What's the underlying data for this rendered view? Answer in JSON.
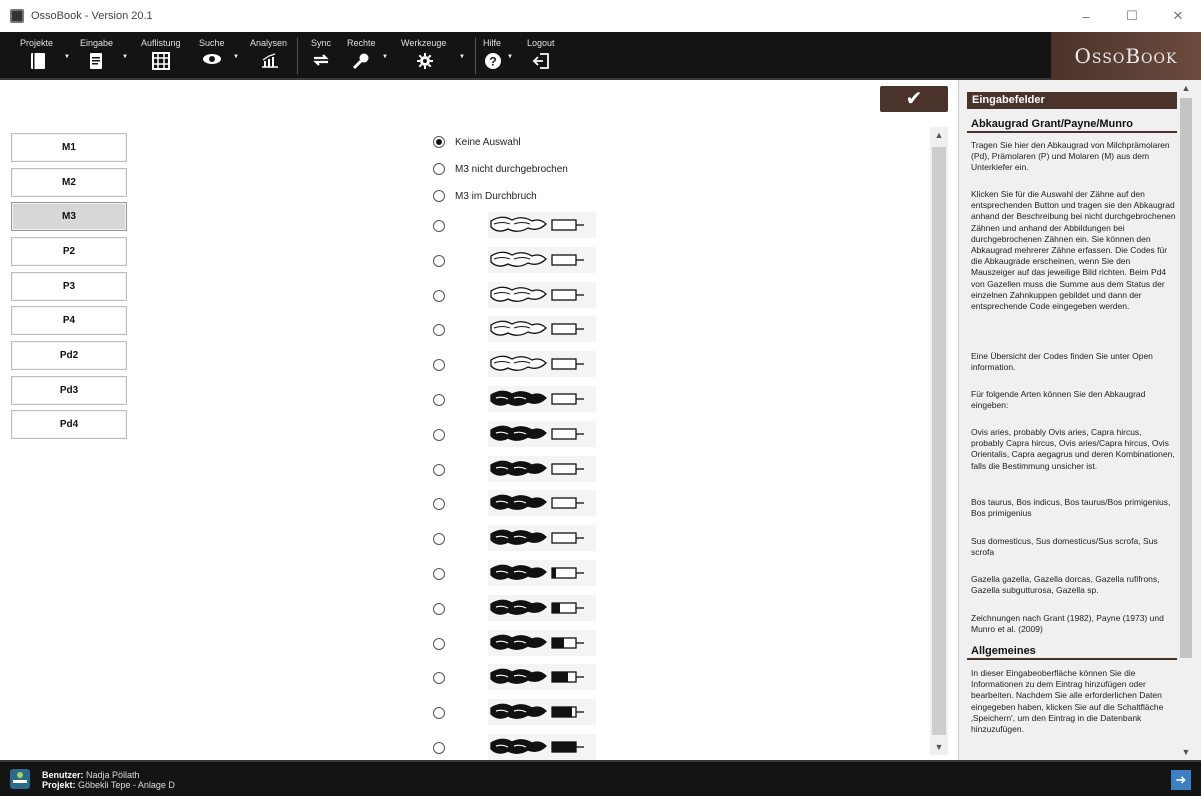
{
  "window": {
    "title": "OssoBook - Version 20.1",
    "minimize": "–",
    "maximize": "☐",
    "close": "✕"
  },
  "brand": "OssoBook",
  "menu": [
    {
      "label": "Projekte",
      "icon": "notebook-icon"
    },
    {
      "label": "Eingabe",
      "icon": "form-icon"
    },
    {
      "label": "Auflistung",
      "icon": "grid-icon"
    },
    {
      "label": "Suche",
      "icon": "eye-icon"
    },
    {
      "label": "Analysen",
      "icon": "chart-icon"
    },
    {
      "label": "Sync",
      "icon": "sync-icon"
    },
    {
      "label": "Rechte",
      "icon": "key-icon"
    },
    {
      "label": "Werkzeuge",
      "icon": "gear-icon"
    },
    {
      "label": "Hilfe",
      "icon": "help-icon"
    },
    {
      "label": "Logout",
      "icon": "logout-icon"
    }
  ],
  "teeth": [
    "M1",
    "M2",
    "M3",
    "P2",
    "P3",
    "P4",
    "Pd2",
    "Pd3",
    "Pd4"
  ],
  "selected_tooth": "M3",
  "options": {
    "none": "Keine Auswahl",
    "not_erupted": "M3 nicht durchgebrochen",
    "erupting": "M3 im Durchbruch"
  },
  "help": {
    "header": "Eingabefelder",
    "sub1": "Abkaugrad Grant/Payne/Munro",
    "p1": "Tragen Sie hier den Abkaugrad von Milchprämolaren (Pd), Prämolaren (P) und Molaren (M) aus dem Unterkiefer ein.",
    "p2": "Klicken Sie für die Auswahl der Zähne auf den entsprechenden Button und tragen sie den Abkaugrad anhand der Beschreibung bei nicht durchgebrochenen Zähnen und anhand der Abbildungen bei durchgebrochenen Zähnen ein. Sie können den Abkaugrad mehrerer Zähne erfassen. Die Codes für die Abkaugrade erscheinen, wenn Sie den Mauszeiger auf das jeweilige Bild richten. Beim Pd4 von Gazellen muss die Summe aus dem Status der einzelnen Zahnkuppen gebildet und dann der entsprechende Code eingegeben werden.",
    "p3": "Eine Übersicht der Codes finden Sie unter Open information.",
    "p4": "Für folgende Arten können Sie den Abkaugrad eingeben:",
    "p5": "Ovis aries, probably Ovis aries, Capra hircus, probably Capra hircus, Ovis aries/Capra hircus, Ovis Orientalis, Capra aegagrus und deren Kombinationen, falls die Bestimmung unsicher ist.",
    "p6": "Bos taurus, Bos indicus, Bos taurus/Bos primigenius, Bos primigenius",
    "p7": "Sus domesticus, Sus domesticus/Sus scrofa, Sus scrofa",
    "p8": "Gazella gazella, Gazella dorcas, Gazella rufifrons, Gazella subgutturosa, Gazella sp.",
    "p9": "Zeichnungen nach Grant (1982), Payne (1973) und Munro et al. (2009)",
    "sub2": "Allgemeines",
    "p10": "In dieser Eingabeoberfläche können Sie die Informationen zu dem Eintrag hinzufügen oder bearbeiten. Nachdem Sie alle erforderlichen Daten eingegeben haben, klicken Sie auf die Schaltfläche ‚Speichern', um den Eintrag in die Datenbank hinzuzufügen."
  },
  "status": {
    "user_label": "Benutzer:",
    "user": "Nadja Pöllath",
    "project_label": "Projekt:",
    "project": "Göbekli Tepe - Anlage D"
  }
}
